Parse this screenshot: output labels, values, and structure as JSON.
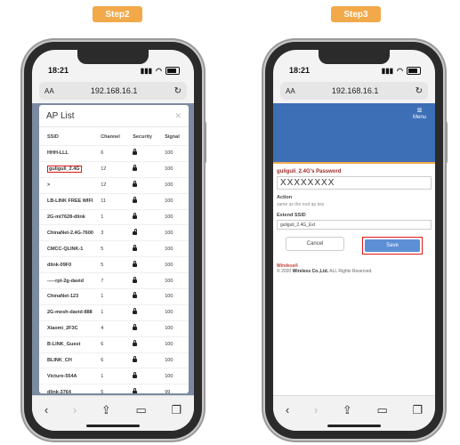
{
  "step_left": "Step2",
  "step_right": "Step3",
  "phone_left": {
    "time": "18:21",
    "url_aa": "AA",
    "url": "192.168.16.1",
    "modal_title": "AP List",
    "columns": [
      "SSID",
      "Channel",
      "Security",
      "Signal"
    ],
    "rows": [
      {
        "ssid": "HHH-LLL",
        "channel": "6",
        "signal": "100",
        "lock": "locked"
      },
      {
        "ssid": "guliguli_2.4G",
        "channel": "12",
        "signal": "100",
        "lock": "locked",
        "highlight": true
      },
      {
        "ssid": ">",
        "channel": "12",
        "signal": "100",
        "lock": "locked"
      },
      {
        "ssid": "LB-LINK FREE WIFI",
        "channel": "11",
        "signal": "100",
        "lock": "locked"
      },
      {
        "ssid": "2G-mt7628-dlink",
        "channel": "1",
        "signal": "100",
        "lock": "locked"
      },
      {
        "ssid": "ChinaNet-2.4G-7600",
        "channel": "3",
        "signal": "100",
        "lock": "open"
      },
      {
        "ssid": "CMCC-QLINK-1",
        "channel": "5",
        "signal": "100",
        "lock": "locked"
      },
      {
        "ssid": "dlink-09F0",
        "channel": "5",
        "signal": "100",
        "lock": "locked"
      },
      {
        "ssid": "-----rpt-2g-david",
        "channel": "7",
        "signal": "100",
        "lock": "locked"
      },
      {
        "ssid": "ChinaNet-123",
        "channel": "1",
        "signal": "100",
        "lock": "locked"
      },
      {
        "ssid": "2G-mesh-david-888",
        "channel": "1",
        "signal": "100",
        "lock": "locked"
      },
      {
        "ssid": "Xiaomi_2F3C",
        "channel": "4",
        "signal": "100",
        "lock": "locked"
      },
      {
        "ssid": "B-LINK_Guest",
        "channel": "6",
        "signal": "100",
        "lock": "locked"
      },
      {
        "ssid": "BLINK_CH",
        "channel": "6",
        "signal": "100",
        "lock": "locked"
      },
      {
        "ssid": "Victure-554A",
        "channel": "1",
        "signal": "100",
        "lock": "locked"
      },
      {
        "ssid": "dlink-3764",
        "channel": "5",
        "signal": "99",
        "lock": "locked"
      }
    ]
  },
  "phone_right": {
    "time": "18:21",
    "url_aa": "AA",
    "url": "192.168.16.1",
    "menu_label": "Menu",
    "password_label": "guliguli_2.4G's Password",
    "password_value": "XXXXXXXX",
    "action_label": "Action",
    "action_sub": "same as the root ap key",
    "extend_label": "Extend SSID",
    "extend_value": "guliguli_2.4G_Ext",
    "cancel": "Cancel",
    "save": "Save",
    "footer_brand": "Wireless®",
    "footer_prefix": "© 2020",
    "footer_company": "Wireless Co.,Ltd.",
    "footer_suffix": "ALL Rights Reserved."
  }
}
